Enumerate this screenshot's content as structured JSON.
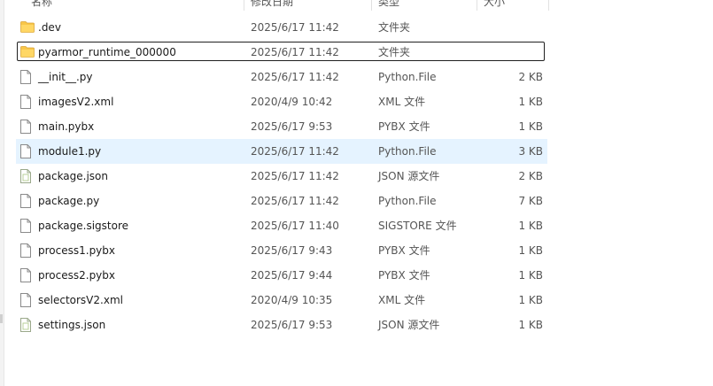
{
  "header": {
    "name": "名称",
    "date": "修改日期",
    "type": "类型",
    "size": "大小"
  },
  "colors": {
    "selected_row": "#e5f3ff",
    "folder": "#f8c649",
    "json_file_accent": "#b9d19a"
  },
  "files": [
    {
      "icon": "folder-icon",
      "name": ".dev",
      "date": "2025/6/17 11:42",
      "type": "文件夹",
      "size": ""
    },
    {
      "icon": "folder-icon",
      "name": "pyarmor_runtime_000000",
      "date": "2025/6/17 11:42",
      "type": "文件夹",
      "size": "",
      "focused": true
    },
    {
      "icon": "file-icon",
      "name": "__init__.py",
      "date": "2025/6/17 11:42",
      "type": "Python.File",
      "size": "2 KB"
    },
    {
      "icon": "file-icon",
      "name": "imagesV2.xml",
      "date": "2020/4/9 10:42",
      "type": "XML 文件",
      "size": "1 KB"
    },
    {
      "icon": "file-icon",
      "name": "main.pybx",
      "date": "2025/6/17 9:53",
      "type": "PYBX 文件",
      "size": "1 KB"
    },
    {
      "icon": "file-icon",
      "name": "module1.py",
      "date": "2025/6/17 11:42",
      "type": "Python.File",
      "size": "3 KB",
      "selected": true
    },
    {
      "icon": "json-file-icon",
      "name": "package.json",
      "date": "2025/6/17 11:42",
      "type": "JSON 源文件",
      "size": "2 KB"
    },
    {
      "icon": "file-icon",
      "name": "package.py",
      "date": "2025/6/17 11:42",
      "type": "Python.File",
      "size": "7 KB"
    },
    {
      "icon": "file-icon",
      "name": "package.sigstore",
      "date": "2025/6/17 11:40",
      "type": "SIGSTORE 文件",
      "size": "1 KB"
    },
    {
      "icon": "file-icon",
      "name": "process1.pybx",
      "date": "2025/6/17 9:43",
      "type": "PYBX 文件",
      "size": "1 KB"
    },
    {
      "icon": "file-icon",
      "name": "process2.pybx",
      "date": "2025/6/17 9:44",
      "type": "PYBX 文件",
      "size": "1 KB"
    },
    {
      "icon": "file-icon",
      "name": "selectorsV2.xml",
      "date": "2020/4/9 10:35",
      "type": "XML 文件",
      "size": "1 KB"
    },
    {
      "icon": "json-file-icon",
      "name": "settings.json",
      "date": "2025/6/17 9:53",
      "type": "JSON 源文件",
      "size": "1 KB"
    }
  ]
}
